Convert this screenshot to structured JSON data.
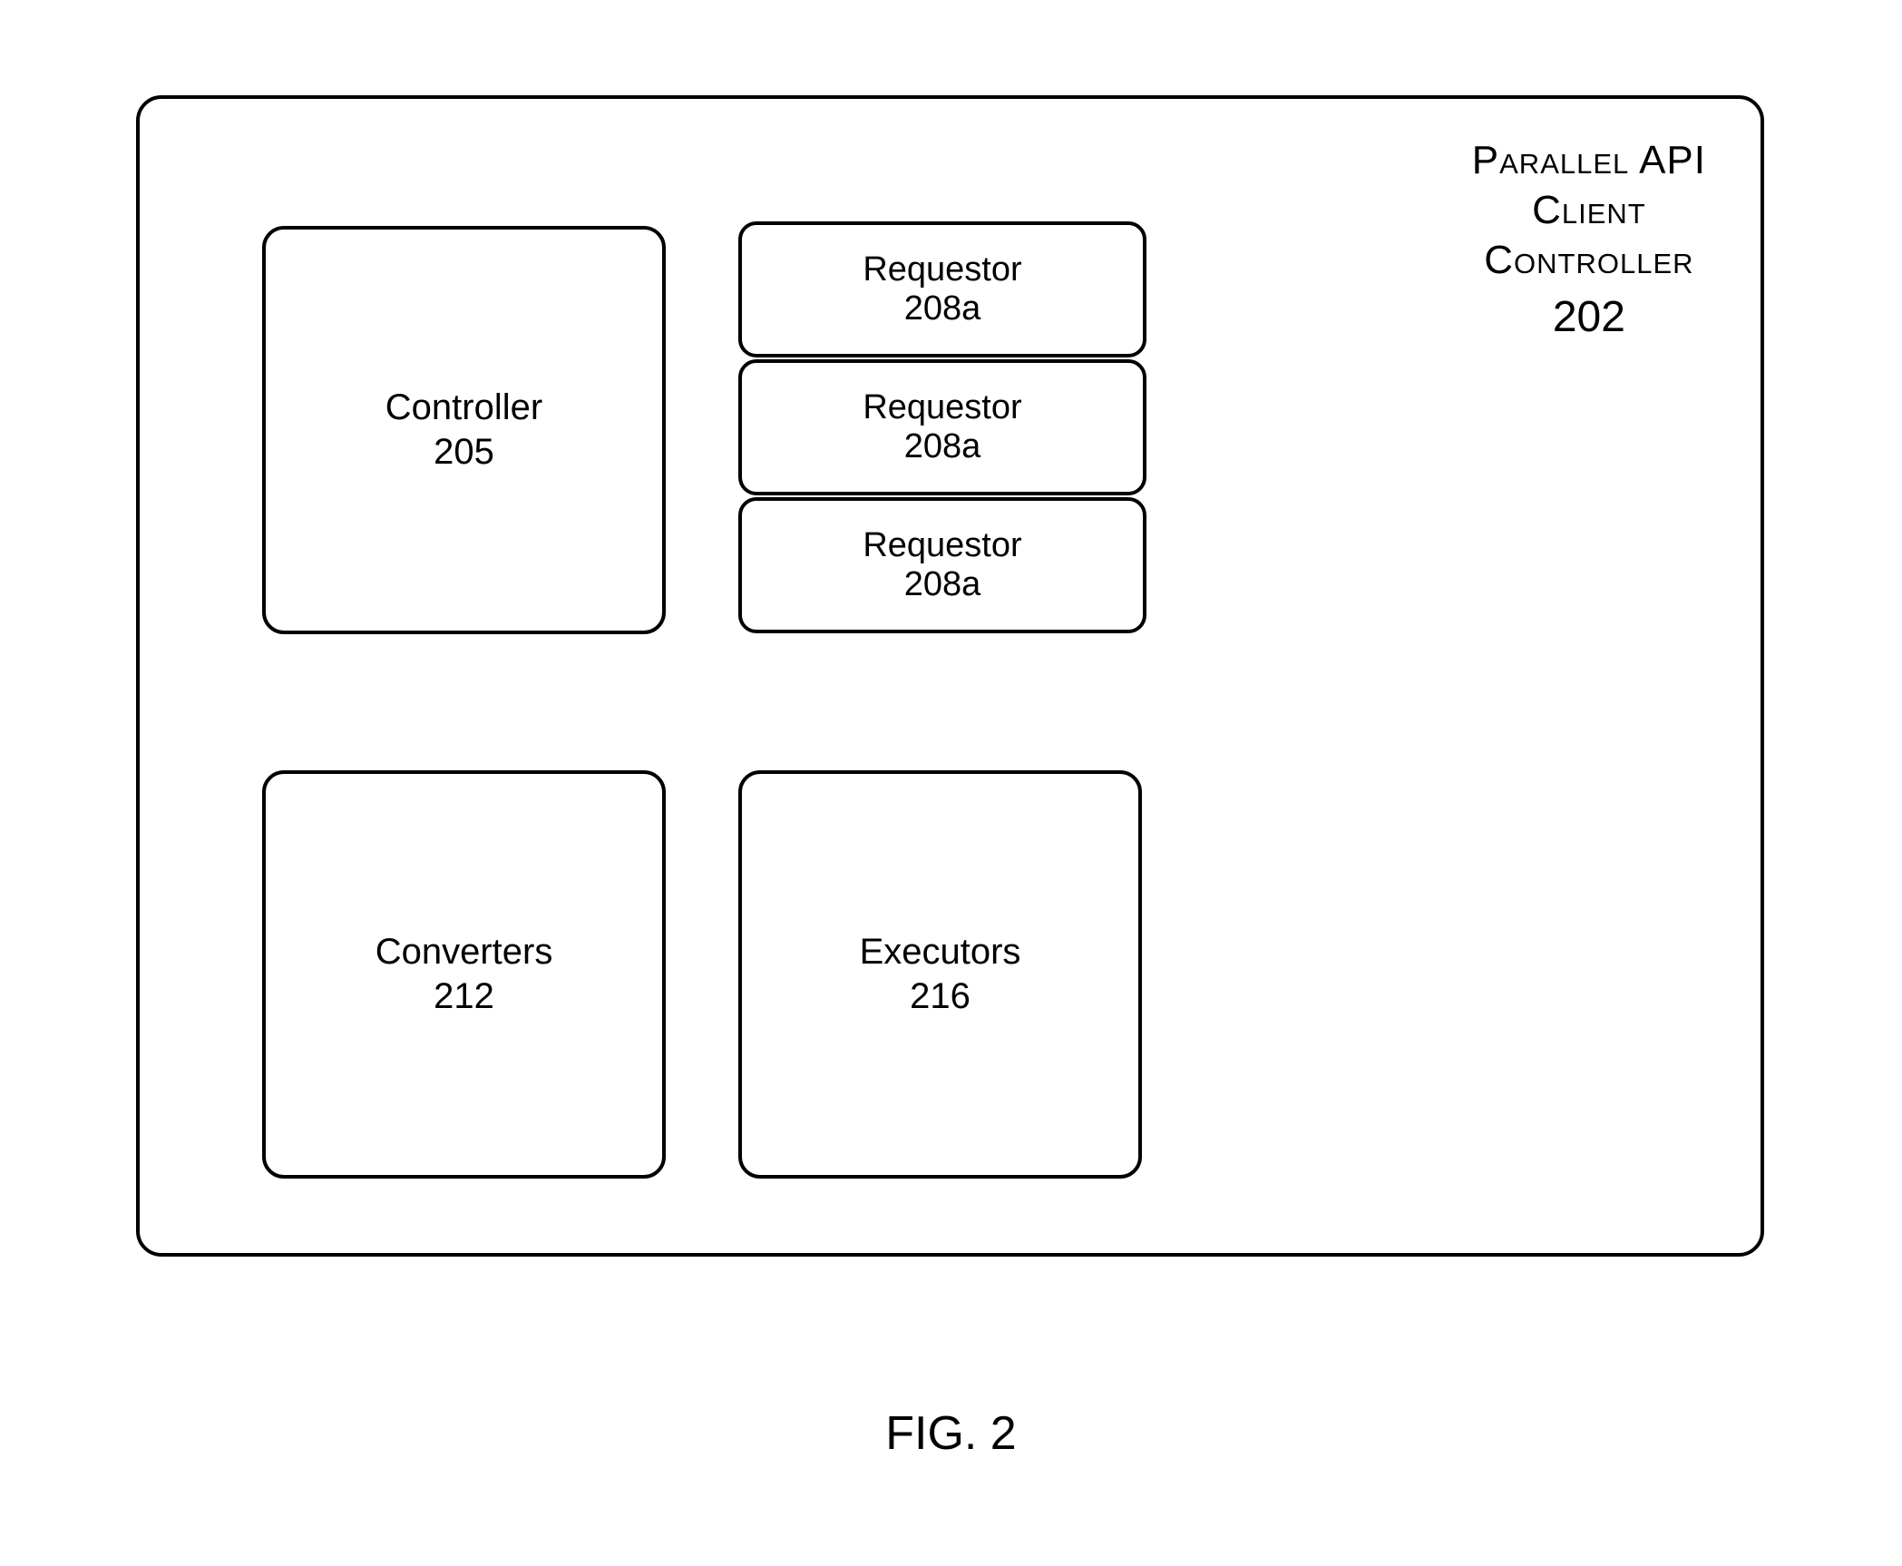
{
  "title": {
    "line1": "Parallel API",
    "line2": "Client",
    "line3": "Controller",
    "num": "202"
  },
  "controller": {
    "label": "Controller",
    "num": "205"
  },
  "requestors": [
    {
      "label": "Requestor",
      "num": "208a"
    },
    {
      "label": "Requestor",
      "num": "208a"
    },
    {
      "label": "Requestor",
      "num": "208a"
    }
  ],
  "converters": {
    "label": "Converters",
    "num": "212"
  },
  "executors": {
    "label": "Executors",
    "num": "216"
  },
  "figcap": "FIG. 2"
}
